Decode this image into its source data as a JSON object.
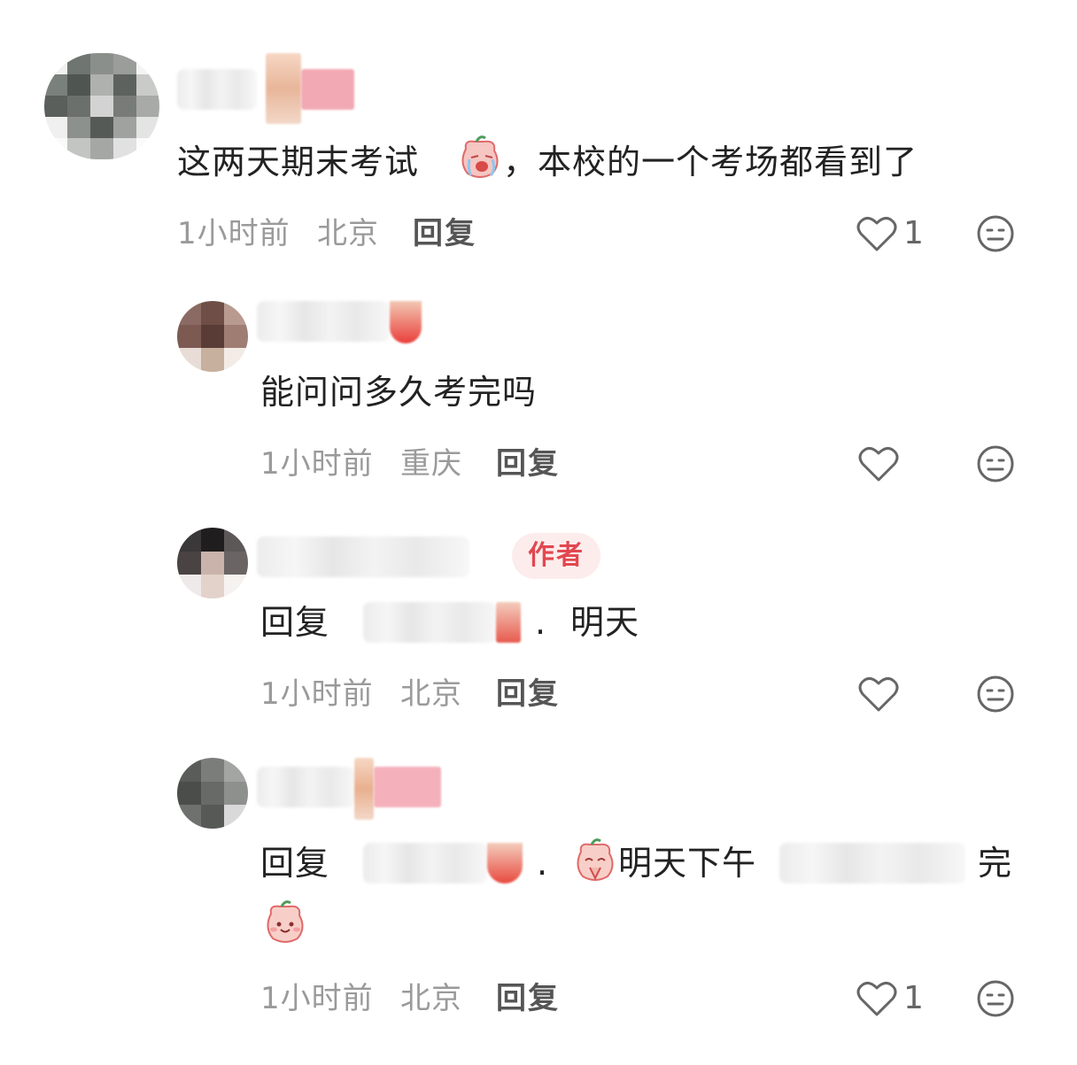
{
  "comments": [
    {
      "text_a": "这两天期末考试",
      "text_b": "，本校的一个考场都看到了",
      "time": "1小时前",
      "location": "北京",
      "reply_label": "回复",
      "likes": "1"
    },
    {
      "text": "能问问多久考完吗",
      "time": "1小时前",
      "location": "重庆",
      "reply_label": "回复",
      "likes": ""
    },
    {
      "badge": "作者",
      "prefix": "回复",
      "dot": ".",
      "text": "明天",
      "time": "1小时前",
      "location": "北京",
      "reply_label": "回复",
      "likes": ""
    },
    {
      "prefix": "回复",
      "dot": ".",
      "text_a": "明天下午",
      "text_b": "完",
      "time": "1小时前",
      "location": "北京",
      "reply_label": "回复",
      "likes": "1"
    }
  ],
  "icons": {
    "like": "heart-outline-icon",
    "dislike": "neutral-face-icon",
    "emoji_1": "crying-peach-emoji",
    "emoji_2": "praying-peach-emoji",
    "emoji_3": "smiling-peach-emoji"
  },
  "colors": {
    "badge_text": "#e2474f",
    "badge_bg": "#fdecec",
    "meta": "#9a9a9a"
  }
}
